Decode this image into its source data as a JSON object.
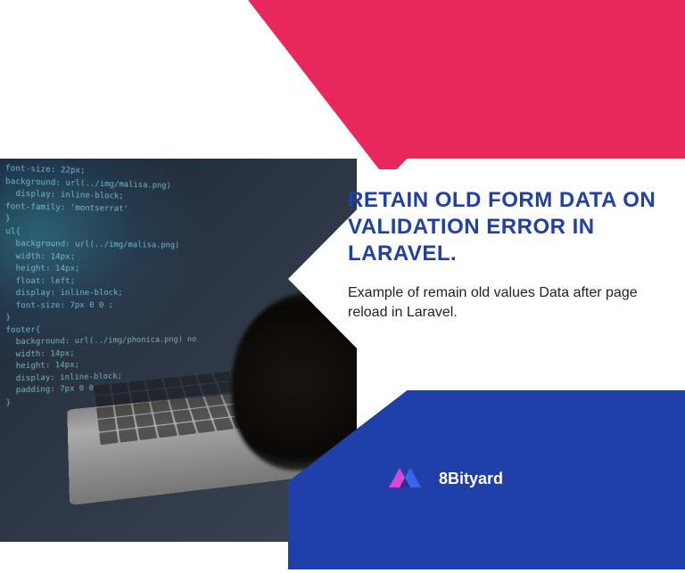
{
  "heading": "RETAIN OLD FORM DATA ON VALIDATION ERROR IN LARAVEL.",
  "subtitle": "Example of remain old values Data after page reload in Laravel.",
  "brand": {
    "name": "8Bityard"
  },
  "code_snippet": "font-size: 22px;\nbackground: url(../img/malisa.png)\n  display: inline-block;\nfont-family: 'montserrat'\n}\nul{\n  background: url(../img/malisa.png)\n  width: 14px;\n  height: 14px;\n  float: left;\n  display: inline-block;\n  font-size: 7px 0 0 ;\n}\nfooter{\n  background: url(../img/phonica.png) no\n  width: 14px;\n  height: 14px;\n  display: inline-block;\n  padding: 7px 0 0\n}",
  "colors": {
    "red_accent": "#e8285c",
    "blue_accent": "#1f40a8",
    "logo_magenta": "#d846d6",
    "logo_blue": "#3866e8"
  }
}
